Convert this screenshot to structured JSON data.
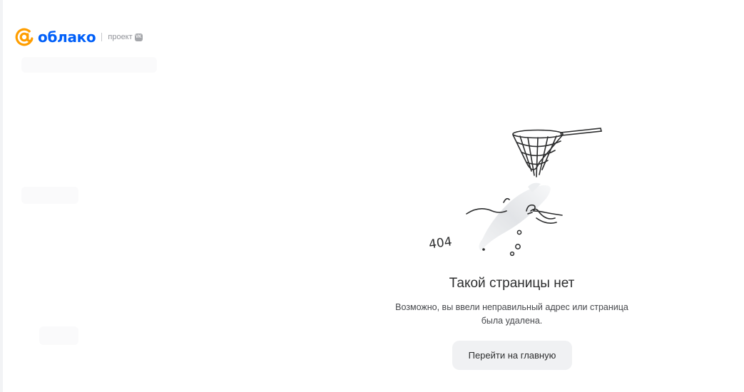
{
  "header": {
    "logo_text": "облако",
    "project_label": "проект",
    "vk_badge": "VK"
  },
  "error": {
    "code": "404",
    "title": "Такой страницы нет",
    "message_line1": "Возможно, вы ввели неправильный адрес или страница",
    "message_line2": "была удалена.",
    "button_label": "Перейти на главную"
  },
  "icons": {
    "logo": "at-sign-icon",
    "badge": "vk-icon",
    "illustration": "fish-escaping-net-illustration"
  },
  "colors": {
    "brand_orange": "#ff9e00",
    "brand_blue": "#005ff9",
    "button_bg": "#f0f1f3",
    "text_primary": "#2c2d2e"
  }
}
